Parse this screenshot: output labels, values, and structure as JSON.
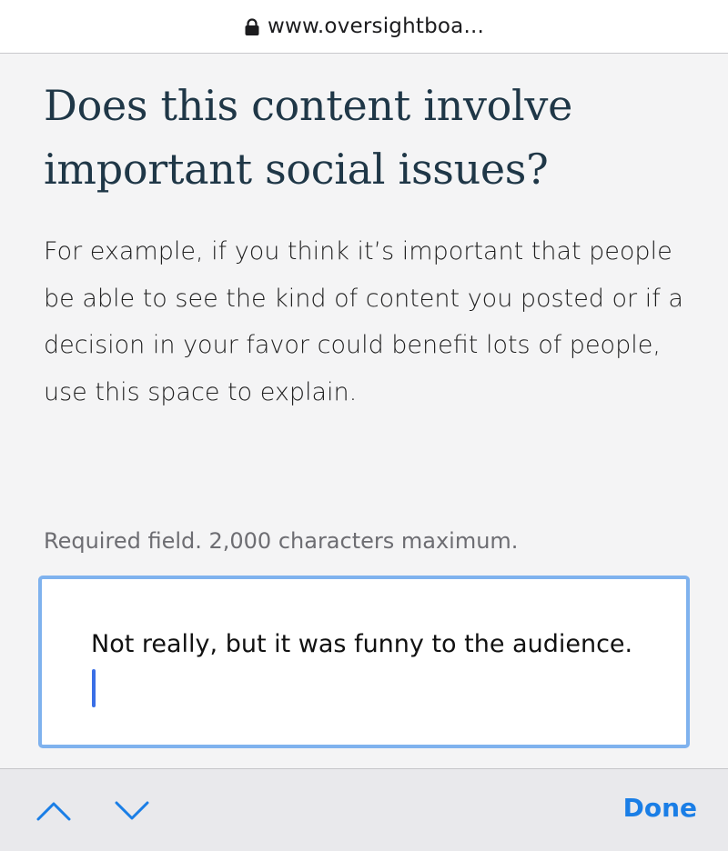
{
  "browser": {
    "url": "www.oversightboa...",
    "lock_icon": "lock-icon"
  },
  "form": {
    "question": "Does this content involve important social issues?",
    "description": "For example, if you think it’s important that people be able to see the kind of content you posted or if a decision in your favor could benefit lots of people, use this space to explain.",
    "requirement_hint": "Required field. 2,000 characters maximum.",
    "answer_value": "Not really, but it was funny to the audience."
  },
  "keyboard_toolbar": {
    "prev_icon": "chevron-up-icon",
    "next_icon": "chevron-down-icon",
    "done_label": "Done"
  },
  "colors": {
    "accent": "#1a7ee6",
    "heading": "#1f3747",
    "field_border": "#7fb2ee",
    "caret": "#3a6fe6",
    "background": "#f4f4f5"
  }
}
